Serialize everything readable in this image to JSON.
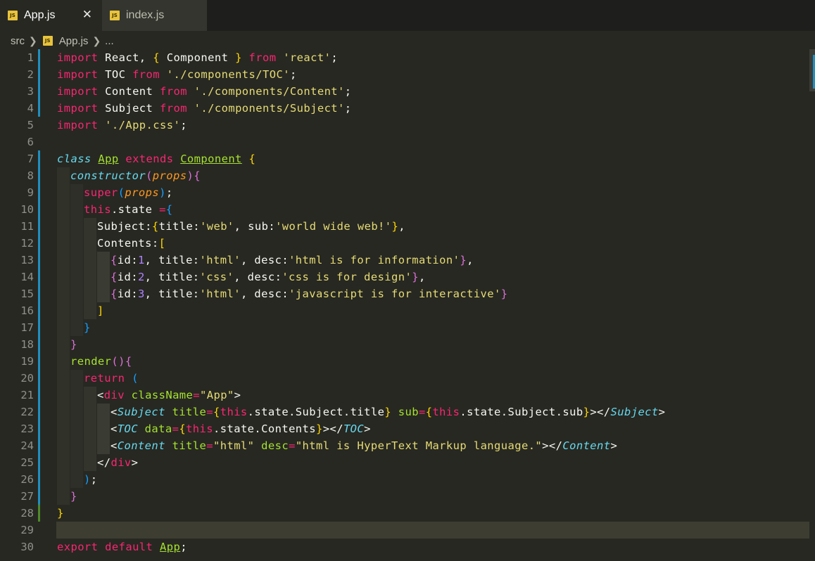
{
  "tabs": [
    {
      "icon": "JS",
      "label": "App.js",
      "active": true,
      "close": "✕"
    },
    {
      "icon": "JS",
      "label": "index.js",
      "active": false
    }
  ],
  "breadcrumb": {
    "folder": "src",
    "file_icon": "JS",
    "file": "App.js",
    "more": "..."
  },
  "editor": {
    "current_line": 29,
    "line_numbers": [
      "1",
      "2",
      "3",
      "4",
      "5",
      "6",
      "7",
      "8",
      "9",
      "10",
      "11",
      "12",
      "13",
      "14",
      "15",
      "16",
      "17",
      "18",
      "19",
      "20",
      "21",
      "22",
      "23",
      "24",
      "25",
      "26",
      "27",
      "28",
      "29",
      "30"
    ]
  },
  "colors": {
    "background": "#272822",
    "keyword": "#F92672",
    "string": "#E6DB74",
    "function": "#A6E22E",
    "storage": "#66D9EF",
    "number": "#AE81FF",
    "parameter": "#FD971F",
    "gutter_modified": "#1f8fbf",
    "gutter_added": "#4f8a2a"
  },
  "code": {
    "l1": [
      "import",
      " React, ",
      "{",
      " Component ",
      "}",
      " ",
      "from",
      " ",
      "'react'",
      ";"
    ],
    "l2": [
      "import",
      " TOC ",
      "from",
      " ",
      "'./components/TOC'",
      ";"
    ],
    "l3": [
      "import",
      " Content ",
      "from",
      " ",
      "'./components/Content'",
      ";"
    ],
    "l4": [
      "import",
      " Subject ",
      "from",
      " ",
      "'./components/Subject'",
      ";"
    ],
    "l5": [
      "import",
      " ",
      "'./App.css'",
      ";"
    ],
    "l7": [
      "class",
      " ",
      "App",
      " ",
      "extends",
      " ",
      "Component",
      " ",
      "{"
    ],
    "l8": [
      "constructor",
      "(",
      "props",
      ")",
      "{"
    ],
    "l9": [
      "super",
      "(",
      "props",
      ")",
      ";"
    ],
    "l10": [
      "this",
      ".state ",
      "=",
      "{"
    ],
    "l11": [
      "Subject:",
      "{",
      "title:",
      "'web'",
      ", sub:",
      "'world wide web!'",
      "}",
      ","
    ],
    "l12": [
      "Contents:",
      "["
    ],
    "l13": [
      "{",
      "id:",
      "1",
      ", title:",
      "'html'",
      ", desc:",
      "'html is for information'",
      "}",
      ","
    ],
    "l14": [
      "{",
      "id:",
      "2",
      ", title:",
      "'css'",
      ", desc:",
      "'css is for design'",
      "}",
      ","
    ],
    "l15": [
      "{",
      "id:",
      "3",
      ", title:",
      "'html'",
      ", desc:",
      "'javascript is for interactive'",
      "}"
    ],
    "l16": [
      "]"
    ],
    "l17": [
      "}"
    ],
    "l18": [
      "}"
    ],
    "l19": [
      "render",
      "(",
      ")",
      "{"
    ],
    "l20": [
      "return",
      " ",
      "("
    ],
    "l21": [
      "<",
      "div",
      " ",
      "className",
      "=",
      "\"App\"",
      ">"
    ],
    "l22": [
      "<",
      "Subject",
      " ",
      "title",
      "=",
      "{",
      "this",
      ".state.Subject.title",
      "}",
      " ",
      "sub",
      "=",
      "{",
      "this",
      ".state.Subject.sub",
      "}",
      "></",
      "Subject",
      ">"
    ],
    "l23": [
      "<",
      "TOC",
      " ",
      "data",
      "=",
      "{",
      "this",
      ".state.Contents",
      "}",
      "></",
      "TOC",
      ">"
    ],
    "l24": [
      "<",
      "Content",
      " ",
      "title",
      "=",
      "\"html\"",
      " ",
      "desc",
      "=",
      "\"html is HyperText Markup language.\"",
      "></",
      "Content",
      ">"
    ],
    "l25": [
      "</",
      "div",
      ">"
    ],
    "l26": [
      ")",
      ";"
    ],
    "l27": [
      "}"
    ],
    "l28": [
      "}"
    ],
    "l30": [
      "export",
      " ",
      "default",
      " ",
      "App",
      ";"
    ]
  }
}
